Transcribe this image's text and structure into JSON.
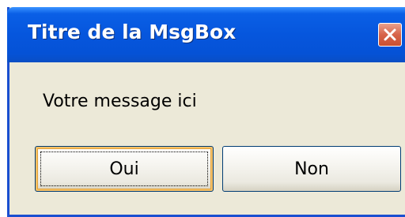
{
  "dialog": {
    "title": "Titre de la MsgBox",
    "message": "Votre message ici",
    "buttons": {
      "yes_label": "Oui",
      "no_label": "Non"
    },
    "close_icon": "close-icon"
  },
  "colors": {
    "titlebar": "#0656dd",
    "window_background": "#ece9d8",
    "close_button": "#d7644a",
    "default_button_highlight": "#f6c167"
  }
}
